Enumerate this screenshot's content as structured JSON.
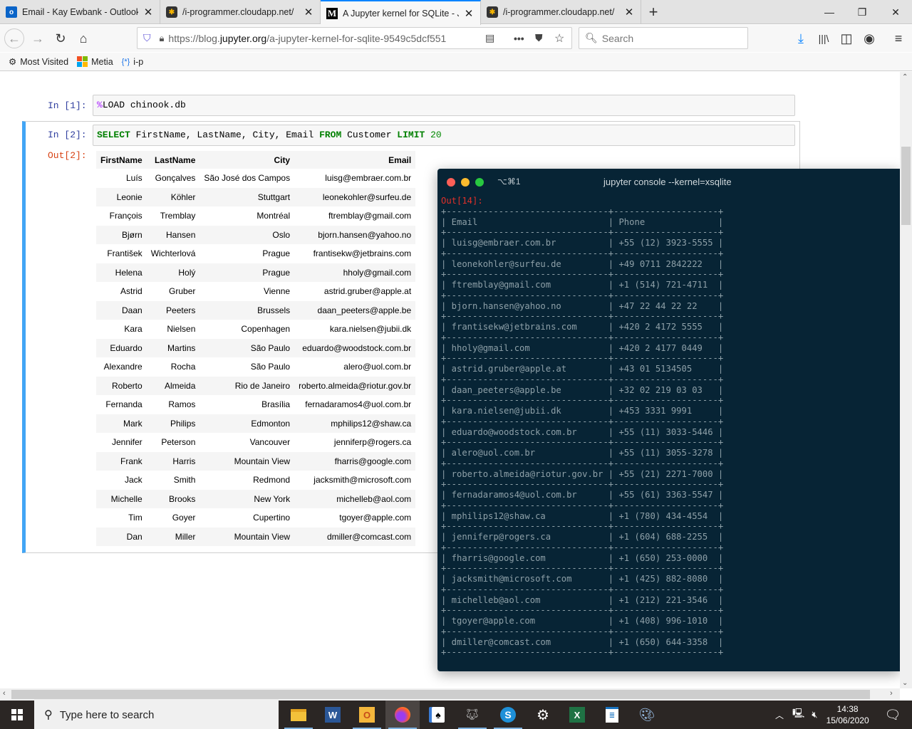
{
  "browser": {
    "tabs": [
      {
        "title": "Email - Kay Ewbank - Outlook",
        "icon": "outlook-icon",
        "active": false
      },
      {
        "title": "/i-programmer.cloudapp.net/",
        "icon": "joomla-icon",
        "active": false
      },
      {
        "title": "A Jupyter kernel for SQLite - Ju",
        "icon": "medium-icon",
        "active": true
      },
      {
        "title": "/i-programmer.cloudapp.net/",
        "icon": "joomla-icon",
        "active": false
      }
    ],
    "new_tab": "+",
    "window_controls": {
      "minimize": "—",
      "restore": "❐",
      "close": "✕"
    },
    "url_prefix": "https://blog.",
    "url_domain": "jupyter.org",
    "url_path": "/a-jupyter-kernel-for-sqlite-9549c5dcf551",
    "search_placeholder": "Search",
    "bookmarks": [
      {
        "label": "Most Visited",
        "icon": "gear-icon"
      },
      {
        "label": "Metia",
        "icon": "windows-logo-icon"
      },
      {
        "label": "i-p",
        "icon": "braces-icon"
      }
    ]
  },
  "notebook": {
    "cell1": {
      "prompt": "In [1]:",
      "magic": "%",
      "code": "LOAD chinook.db"
    },
    "cell2": {
      "prompt": "In [2]:",
      "code_parts": [
        {
          "t": "SELECT",
          "k": "kw"
        },
        {
          "t": " FirstName, LastName, City, Email ",
          "k": ""
        },
        {
          "t": "FROM",
          "k": "kw"
        },
        {
          "t": " Customer ",
          "k": ""
        },
        {
          "t": "LIMIT",
          "k": "kw"
        },
        {
          "t": " 20",
          "k": "num"
        }
      ],
      "out_prompt": "Out[2]:",
      "columns": [
        "FirstName",
        "LastName",
        "City",
        "Email"
      ],
      "rows": [
        [
          "Luís",
          "Gonçalves",
          "São José dos Campos",
          "luisg@embraer.com.br"
        ],
        [
          "Leonie",
          "Köhler",
          "Stuttgart",
          "leonekohler@surfeu.de"
        ],
        [
          "François",
          "Tremblay",
          "Montréal",
          "ftremblay@gmail.com"
        ],
        [
          "Bjørn",
          "Hansen",
          "Oslo",
          "bjorn.hansen@yahoo.no"
        ],
        [
          "František",
          "Wichterlová",
          "Prague",
          "frantisekw@jetbrains.com"
        ],
        [
          "Helena",
          "Holý",
          "Prague",
          "hholy@gmail.com"
        ],
        [
          "Astrid",
          "Gruber",
          "Vienne",
          "astrid.gruber@apple.at"
        ],
        [
          "Daan",
          "Peeters",
          "Brussels",
          "daan_peeters@apple.be"
        ],
        [
          "Kara",
          "Nielsen",
          "Copenhagen",
          "kara.nielsen@jubii.dk"
        ],
        [
          "Eduardo",
          "Martins",
          "São Paulo",
          "eduardo@woodstock.com.br"
        ],
        [
          "Alexandre",
          "Rocha",
          "São Paulo",
          "alero@uol.com.br"
        ],
        [
          "Roberto",
          "Almeida",
          "Rio de Janeiro",
          "roberto.almeida@riotur.gov.br"
        ],
        [
          "Fernanda",
          "Ramos",
          "Brasília",
          "fernadaramos4@uol.com.br"
        ],
        [
          "Mark",
          "Philips",
          "Edmonton",
          "mphilips12@shaw.ca"
        ],
        [
          "Jennifer",
          "Peterson",
          "Vancouver",
          "jenniferp@rogers.ca"
        ],
        [
          "Frank",
          "Harris",
          "Mountain View",
          "fharris@google.com"
        ],
        [
          "Jack",
          "Smith",
          "Redmond",
          "jacksmith@microsoft.com"
        ],
        [
          "Michelle",
          "Brooks",
          "New York",
          "michelleb@aol.com"
        ],
        [
          "Tim",
          "Goyer",
          "Cupertino",
          "tgoyer@apple.com"
        ],
        [
          "Dan",
          "Miller",
          "Mountain View",
          "dmiller@comcast.com"
        ]
      ]
    }
  },
  "terminal": {
    "shortcut": "⌥⌘1",
    "title": "jupyter console --kernel=xsqlite",
    "out_prompt": "Out[14]:",
    "columns": [
      "Email",
      "Phone"
    ],
    "rows": [
      [
        "luisg@embraer.com.br",
        "+55 (12) 3923-5555"
      ],
      [
        "leonekohler@surfeu.de",
        "+49 0711 2842222"
      ],
      [
        "ftremblay@gmail.com",
        "+1 (514) 721-4711"
      ],
      [
        "bjorn.hansen@yahoo.no",
        "+47 22 44 22 22"
      ],
      [
        "frantisekw@jetbrains.com",
        "+420 2 4172 5555"
      ],
      [
        "hholy@gmail.com",
        "+420 2 4177 0449"
      ],
      [
        "astrid.gruber@apple.at",
        "+43 01 5134505"
      ],
      [
        "daan_peeters@apple.be",
        "+32 02 219 03 03"
      ],
      [
        "kara.nielsen@jubii.dk",
        "+453 3331 9991"
      ],
      [
        "eduardo@woodstock.com.br",
        "+55 (11) 3033-5446"
      ],
      [
        "alero@uol.com.br",
        "+55 (11) 3055-3278"
      ],
      [
        "roberto.almeida@riotur.gov.br",
        "+55 (21) 2271-7000"
      ],
      [
        "fernadaramos4@uol.com.br",
        "+55 (61) 3363-5547"
      ],
      [
        "mphilips12@shaw.ca",
        "+1 (780) 434-4554"
      ],
      [
        "jenniferp@rogers.ca",
        "+1 (604) 688-2255"
      ],
      [
        "fharris@google.com",
        "+1 (650) 253-0000"
      ],
      [
        "jacksmith@microsoft.com",
        "+1 (425) 882-8080"
      ],
      [
        "michelleb@aol.com",
        "+1 (212) 221-3546"
      ],
      [
        "tgoyer@apple.com",
        "+1 (408) 996-1010"
      ],
      [
        "dmiller@comcast.com",
        "+1 (650) 644-3358"
      ]
    ],
    "colors": {
      "bg": "#072435",
      "text": "#8ea0a8",
      "out_prompt": "#e0302a",
      "close": "#fc5f57",
      "minimize": "#fdbc2e",
      "zoom": "#28c840"
    }
  },
  "taskbar": {
    "search_placeholder": "Type here to search",
    "apps": [
      "file-explorer-icon",
      "word-icon",
      "outlook-icon",
      "firefox-icon",
      "solitaire-icon",
      "gimp-icon",
      "skype-icon",
      "settings-icon",
      "excel-icon",
      "writer-icon",
      "paint-icon"
    ],
    "time": "14:38",
    "date": "15/06/2020"
  }
}
